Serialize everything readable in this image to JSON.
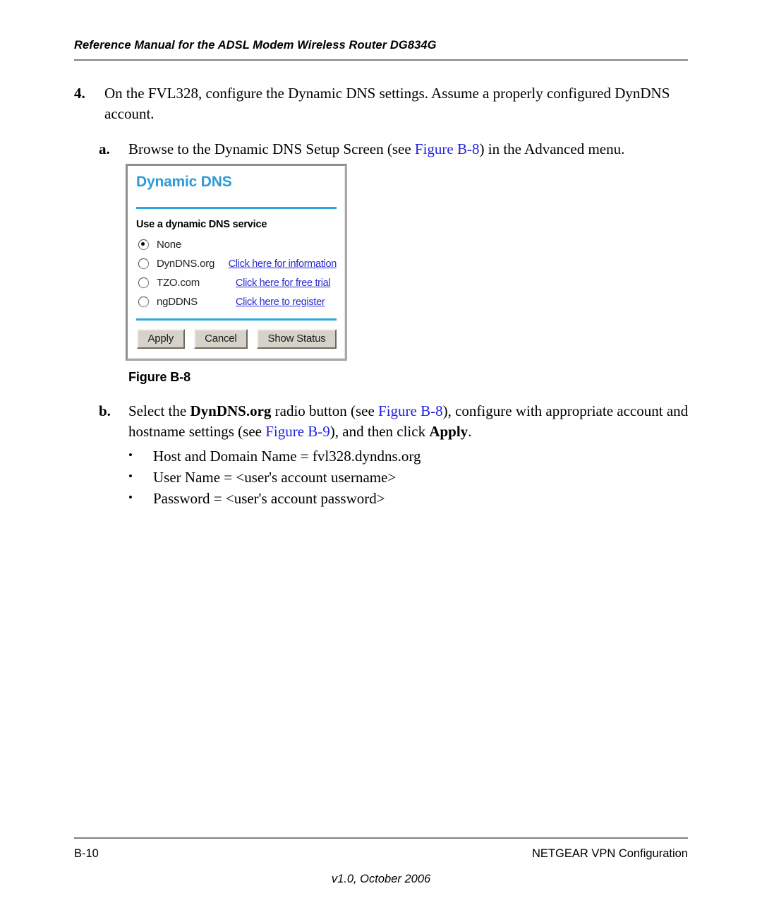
{
  "header": {
    "title": "Reference Manual for the ADSL Modem Wireless Router DG834G"
  },
  "steps": {
    "step4": {
      "marker": "4.",
      "text_part1": "On the FVL328, configure the Dynamic DNS settings. Assume a properly configured DynDNS account."
    },
    "step_a": {
      "marker": "a.",
      "text_part1": "Browse to the Dynamic DNS Setup Screen (see ",
      "xref1": "Figure B-8",
      "text_part2": ") in the Advanced menu."
    },
    "step_b": {
      "marker": "b.",
      "text_part1": "Select the ",
      "bold1": "DynDNS.org",
      "text_part2": " radio button (see ",
      "xref1": "Figure B-8",
      "text_part3": "), configure with appropriate account and hostname settings (see ",
      "xref2": "Figure B-9",
      "text_part4": "), and then click ",
      "bold2": "Apply",
      "text_part5": "."
    },
    "bullets": [
      "Host and Domain Name = fvl328.dyndns.org",
      "User Name = <user's account username>",
      "Password = <user's account password>"
    ],
    "bullet_glyph": "•"
  },
  "figure": {
    "caption": "Figure B-8",
    "panel": {
      "title": "Dynamic DNS",
      "section_label": "Use a dynamic DNS service",
      "options": [
        {
          "label": "None",
          "selected": true,
          "link": ""
        },
        {
          "label": "DynDNS.org",
          "selected": false,
          "link": "Click here for information"
        },
        {
          "label": "TZO.com",
          "selected": false,
          "link": "Click here for free trial"
        },
        {
          "label": "ngDDNS",
          "selected": false,
          "link": "Click here to register"
        }
      ],
      "buttons": {
        "apply": "Apply",
        "cancel": "Cancel",
        "show_status": "Show Status"
      }
    }
  },
  "footer": {
    "page_number": "B-10",
    "section": "NETGEAR VPN Configuration",
    "version": "v1.0, October 2006"
  },
  "colors": {
    "xref_link": "#2222DD",
    "panel_title": "#2E9AD6",
    "panel_rule": "#28A8DD",
    "panel_link": "#2A2AD0",
    "rule_gray": "#808080",
    "button_face": "#D6D2CA"
  }
}
